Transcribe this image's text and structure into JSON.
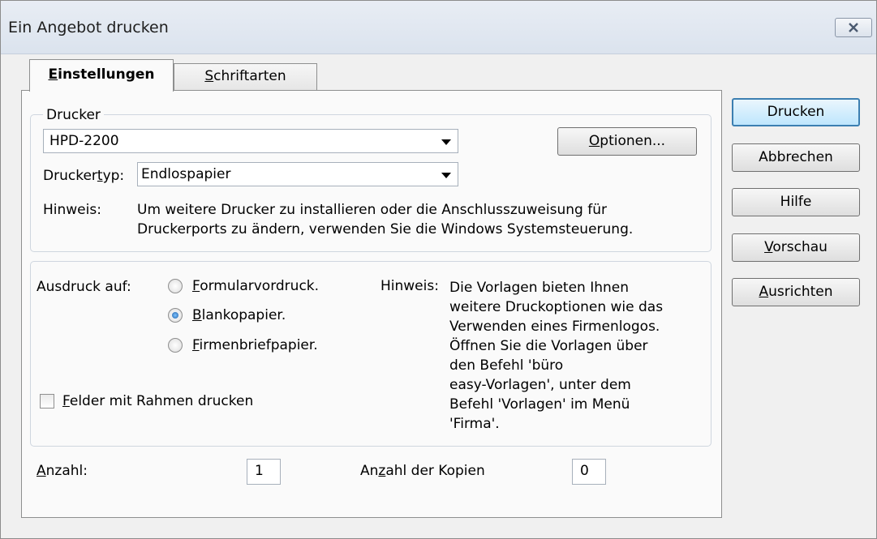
{
  "window": {
    "title": "Ein Angebot drucken"
  },
  "tabs": [
    {
      "label": "Einstellungen",
      "active": true,
      "underline": "E"
    },
    {
      "label": "Schriftarten",
      "active": false,
      "underline": "S"
    }
  ],
  "printer": {
    "group_label": "Drucker",
    "selected": "HPD-2200",
    "options_button": "Optionen...",
    "type_label_pre": "Drucker",
    "type_label_u": "t",
    "type_label_post": "yp:",
    "type_value": "Endlospapier",
    "hint_label": "Hinweis:",
    "hint_line1": "Um weitere Drucker zu installieren oder die Anschlusszuweisung für",
    "hint_line2": "Druckerports zu ändern, verwenden Sie die Windows Systemsteuerung."
  },
  "output": {
    "label": "Ausdruck auf:",
    "options": [
      {
        "u": "F",
        "rest": "ormularvordruck.",
        "checked": false
      },
      {
        "u": "B",
        "rest": "lankopapier.",
        "checked": true
      },
      {
        "u": "F",
        "rest": "irmenbriefpapier.",
        "checked": false
      }
    ],
    "frames_checkbox_u": "F",
    "frames_checkbox_rest": "elder mit Rahmen drucken",
    "frames_checked": false,
    "hint_label": "Hinweis:",
    "hint_lines": [
      "Die Vorlagen bieten Ihnen",
      "weitere Druckoptionen wie das",
      "Verwenden eines Firmenlogos.",
      "Öffnen Sie die Vorlagen über",
      "den Befehl 'büro",
      "easy-Vorlagen', unter dem",
      "Befehl 'Vorlagen' im Menü",
      "'Firma'."
    ]
  },
  "count": {
    "label_u": "A",
    "label_rest": "nzahl:",
    "value": "1",
    "copies_label_pre": "An",
    "copies_label_u": "z",
    "copies_label_post": "ahl der Kopien",
    "copies_value": "0"
  },
  "buttons": {
    "print": "Drucken",
    "cancel": "Abbrechen",
    "help": "Hilfe",
    "preview_u": "V",
    "preview_rest": "orschau",
    "align_u": "A",
    "align_rest": "usrichten"
  }
}
